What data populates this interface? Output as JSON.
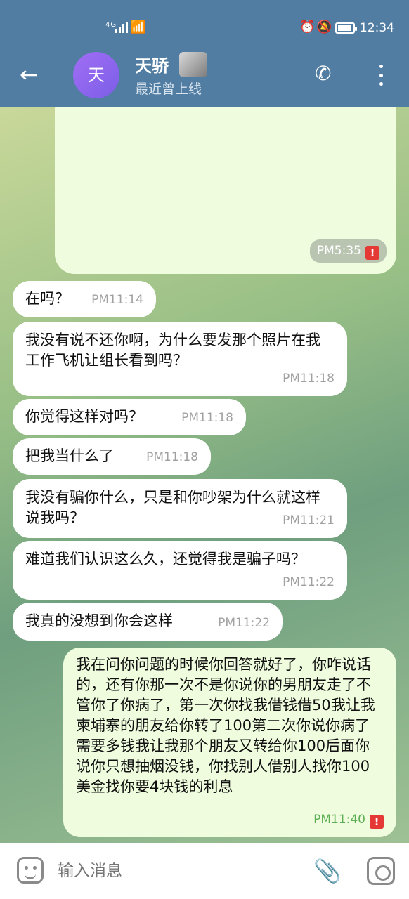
{
  "status_bar": {
    "network": "4G",
    "time": "12:34"
  },
  "header": {
    "avatar_letter": "天",
    "contact_name": "天骄",
    "last_seen": "最近曾上线"
  },
  "messages": [
    {
      "direction": "out",
      "text": "",
      "time": "PM5:35",
      "error": "!"
    },
    {
      "direction": "in",
      "text": "在吗？",
      "time": "PM11:14"
    },
    {
      "direction": "in",
      "text": "我没有说不还你啊，为什么要发那个照片在我工作飞机让组长看到吗？",
      "time": "PM11:18"
    },
    {
      "direction": "in",
      "text": "你觉得这样对吗？",
      "time": "PM11:18"
    },
    {
      "direction": "in",
      "text": "把我当什么了",
      "time": "PM11:18"
    },
    {
      "direction": "in",
      "text": "我没有骗你什么，只是和你吵架为什么就这样说我吗？",
      "time": "PM11:21"
    },
    {
      "direction": "in",
      "text": "难道我们认识这么久，还觉得我是骗子吗？",
      "time": "PM11:22"
    },
    {
      "direction": "in",
      "text": "我真的没想到你会这样",
      "time": "PM11:22"
    },
    {
      "direction": "out",
      "text": "我在问你问题的时候你回答就好了，你咋说话的，还有你那一次不是你说你的男朋友走了不管你了你病了，第一次你找我借钱借50我让我柬埔寨的朋友给你转了100第二次你说你病了需要多钱我让我那个朋友又转给你100后面你说你只想抽烟没钱，你找别人借别人找你100美金找你要4块钱的利息",
      "time": "PM11:40",
      "error": "!"
    }
  ],
  "input": {
    "placeholder": "输入消息"
  },
  "colors": {
    "header_bg": "#517da2",
    "incoming_bubble": "#ffffff",
    "outgoing_bubble": "#effdde",
    "error_badge": "#e53935"
  }
}
